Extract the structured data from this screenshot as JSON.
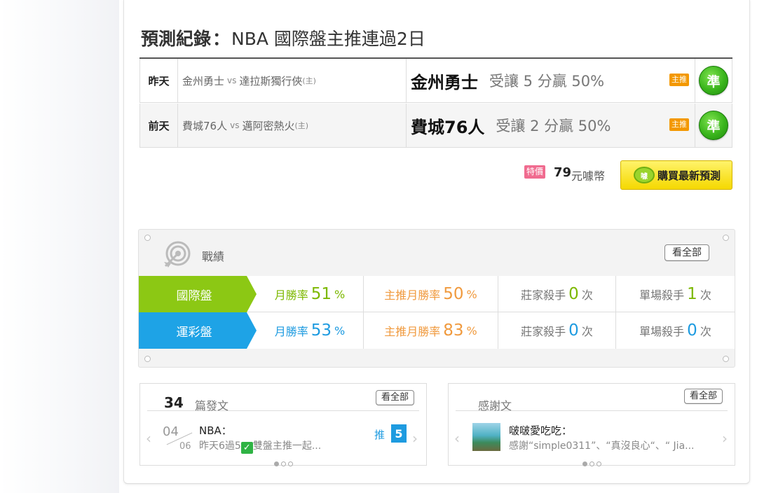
{
  "prediction": {
    "title_label": "預測紀錄",
    "colon": "：",
    "title_text": "NBA 國際盤主推連過2日",
    "rows": [
      {
        "day": "昨天",
        "team_a": "金州勇士",
        "vs": "vs",
        "team_b": "達拉斯獨行俠",
        "home_mark": "(主)",
        "pick_team": "金州勇士",
        "pick_detail": "受讓 5 分贏 50%",
        "tag": "主推",
        "result": "準"
      },
      {
        "day": "前天",
        "team_a": "費城76人",
        "vs": "vs",
        "team_b": "邁阿密熱火",
        "home_mark": "(主)",
        "pick_team": "費城76人",
        "pick_detail": "受讓 2 分贏 50%",
        "tag": "主推",
        "result": "準"
      }
    ]
  },
  "buy": {
    "price_tag": "特價",
    "price": "79",
    "unit": "元噱幣",
    "button_label": "購買最新預測",
    "icon_text": "噱"
  },
  "record": {
    "title": "戰績",
    "view_all": "看全部",
    "rows": [
      {
        "label": "國際盤",
        "color": "#8cc814",
        "monthly_label": "月勝率",
        "monthly_value": "51",
        "main_label": "主推月勝率",
        "main_value": "50",
        "percent": "%",
        "banker_label": "莊家殺手",
        "banker_value": "0",
        "single_label": "單場殺手",
        "single_value": "1",
        "times": "次"
      },
      {
        "label": "運彩盤",
        "color": "#1ea3e6",
        "monthly_label": "月勝率",
        "monthly_value": "53",
        "main_label": "主推月勝率",
        "main_value": "83",
        "percent": "%",
        "banker_label": "莊家殺手",
        "banker_value": "0",
        "single_label": "單場殺手",
        "single_value": "0",
        "times": "次"
      }
    ]
  },
  "posts": {
    "count": "34",
    "label": "篇發文",
    "view_all": "看全部",
    "item": {
      "month": "04",
      "day": "06",
      "title": "NBA：",
      "snippet_before": "昨天6過5",
      "check": "✓",
      "snippet_after": "雙盤主推一起...",
      "push_label": "推",
      "push_count": "5"
    }
  },
  "thanks": {
    "label": "感謝文",
    "view_all": "看全部",
    "item": {
      "name": "啵啵愛吃吃：",
      "snippet": "感謝“simple0311”、“真沒良心“、“ Jia..."
    }
  }
}
